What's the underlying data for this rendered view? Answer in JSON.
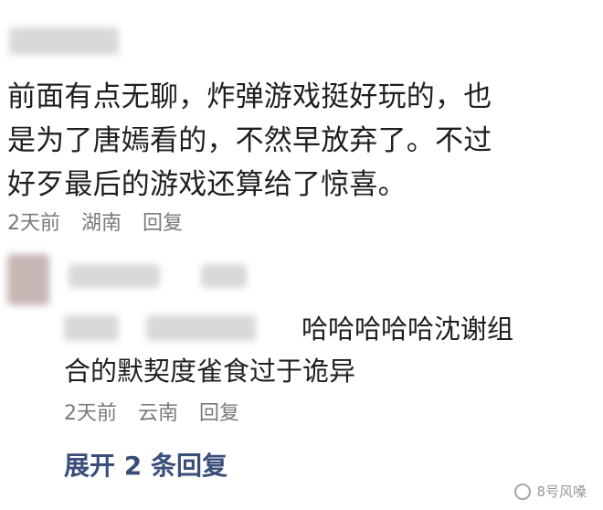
{
  "comment1": {
    "lines": [
      "前面有点无聊，炸弹游戏挺好玩的，也",
      "是为了唐嫣看的，不然早放弃了。不过",
      "好歹最后的游戏还算给了惊喜。"
    ],
    "time": "2天前",
    "location": "湖南",
    "reply_label": "回复"
  },
  "reply1": {
    "line1": "哈哈哈哈哈沈谢组",
    "line2": "合的默契度雀食过于诡异",
    "time": "2天前",
    "location": "云南",
    "reply_label": "回复"
  },
  "expand_label": "展开 2 条回复",
  "watermark": "8号风嗓"
}
